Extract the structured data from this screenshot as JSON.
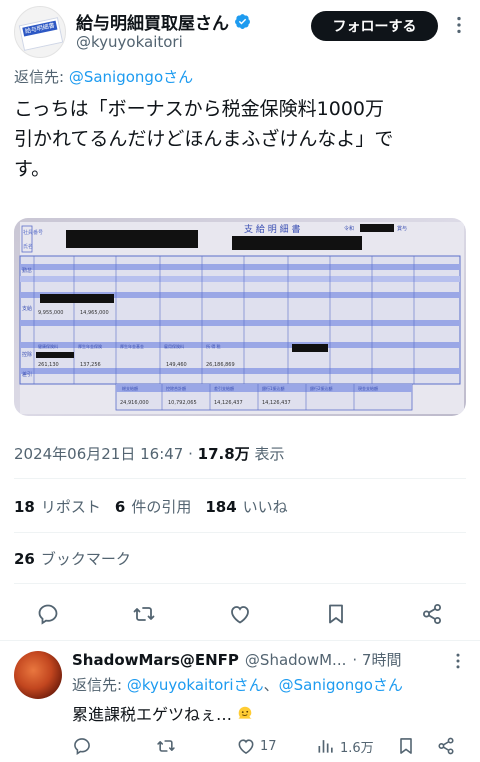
{
  "author": {
    "display_name": "給与明細買取屋さん",
    "handle": "@kyuyokaitori",
    "avatar_text": "給与明細書",
    "follow_label": "フォローする"
  },
  "tweet": {
    "reply_prefix": "返信先: ",
    "reply_target": "@Sanigongoさん",
    "text_line1": "こっちは「ボーナスから税金保険料1000万",
    "text_line2": "引かれてるんだけどほんまふざけんなよ」で",
    "text_line3": "す。",
    "timestamp": "2024年06月21日 16:47",
    "dot": " · ",
    "views_count": "17.8万",
    "views_label": " 表示",
    "reposts_count": "18",
    "reposts_label": "リポスト",
    "quotes_count": "6",
    "quotes_label": "件の引用",
    "likes_count": "184",
    "likes_label": "いいね",
    "bookmarks_count": "26",
    "bookmarks_label": "ブックマーク"
  },
  "photo": {
    "title": "支 給 明 細 書",
    "corner_label": "令和",
    "corner_label2": "賞与",
    "left_labels": [
      "社員番号",
      "氏名"
    ],
    "row_labels": [
      "勤怠",
      "支給",
      "控除",
      "差引"
    ],
    "amount_a": "9,955,000",
    "amount_b": "14,965,000",
    "ded_headers": [
      "健康保険料",
      "厚生年金保険",
      "厚生年金基金",
      "雇用保険料",
      "所 得 税"
    ],
    "ded_values": [
      "261,130",
      "137,256",
      "149,460",
      "26,186,869"
    ],
    "total_headers": [
      "総支給額",
      "控除合計額",
      "差引支給額",
      "銀行1振込額",
      "銀行2振込額",
      "現金支給額"
    ],
    "total_values": [
      "24,916,000",
      "10,792,065",
      "14,126,437",
      "14,126,437"
    ]
  },
  "reply": {
    "name": "ShadowMars@ENFP",
    "handle": "@ShadowM...",
    "time": "· 7時間",
    "reply_prefix": "返信先: ",
    "reply_target1": "@kyuyokaitoriさん",
    "reply_sep": "、",
    "reply_target2": "@Sanigongoさん",
    "text": "累進課税エゲツねぇ…",
    "likes": "17",
    "views": "1.6万"
  },
  "colors": {
    "accent": "#1d9bf0",
    "text_secondary": "#536471",
    "text_primary": "#0f1419"
  },
  "icons": [
    "verified-badge-icon",
    "more-icon",
    "reply-icon",
    "retweet-icon",
    "like-icon",
    "bookmark-icon",
    "share-icon",
    "views-icon",
    "melting-face-emoji"
  ]
}
